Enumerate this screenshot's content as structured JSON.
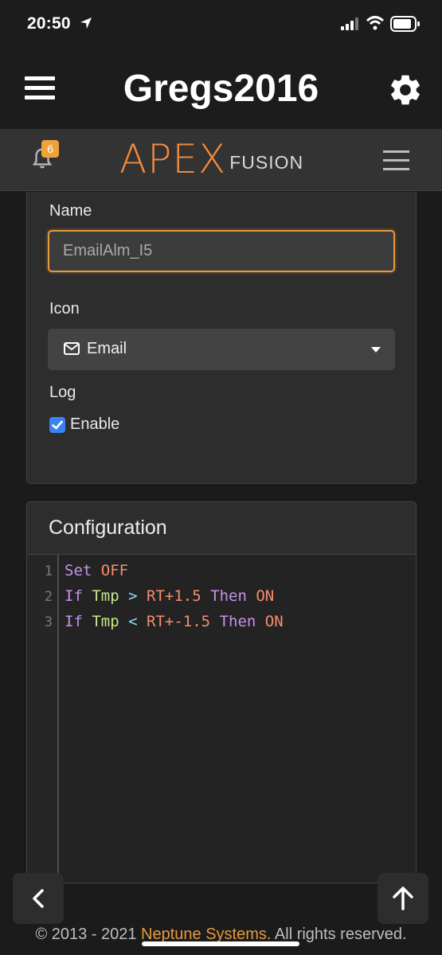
{
  "status_bar": {
    "time": "20:50"
  },
  "header": {
    "title": "Gregs2016",
    "menu_icon": "hamburger-icon",
    "settings_icon": "gear-icon"
  },
  "apex_nav": {
    "notification_count": "6",
    "logo_apex": "APEX",
    "logo_fusion": "FUSION"
  },
  "form": {
    "name_label": "Name",
    "name_value": "EmailAlm_I5",
    "icon_label": "Icon",
    "icon_value": "Email",
    "log_label": "Log",
    "log_enable_label": "Enable",
    "log_enabled": true
  },
  "configuration": {
    "title": "Configuration",
    "line_numbers": [
      "1",
      "2",
      "3"
    ],
    "lines": [
      {
        "kw": "Set",
        "val": "OFF"
      },
      {
        "kw1": "If",
        "var": "Tmp",
        "op": ">",
        "val": "RT+1.5",
        "kw2": "Then",
        "result": "ON"
      },
      {
        "kw1": "If",
        "var": "Tmp",
        "op": "<",
        "val": "RT+-1.5",
        "kw2": "Then",
        "result": "ON"
      }
    ]
  },
  "footer": {
    "prefix": "© 2013 - 2021 ",
    "company": "Neptune Systems.",
    "suffix": " All rights reserved."
  },
  "colors": {
    "accent": "#e79a3e",
    "checkbox": "#3b82f6",
    "badge": "#f0a23a"
  }
}
